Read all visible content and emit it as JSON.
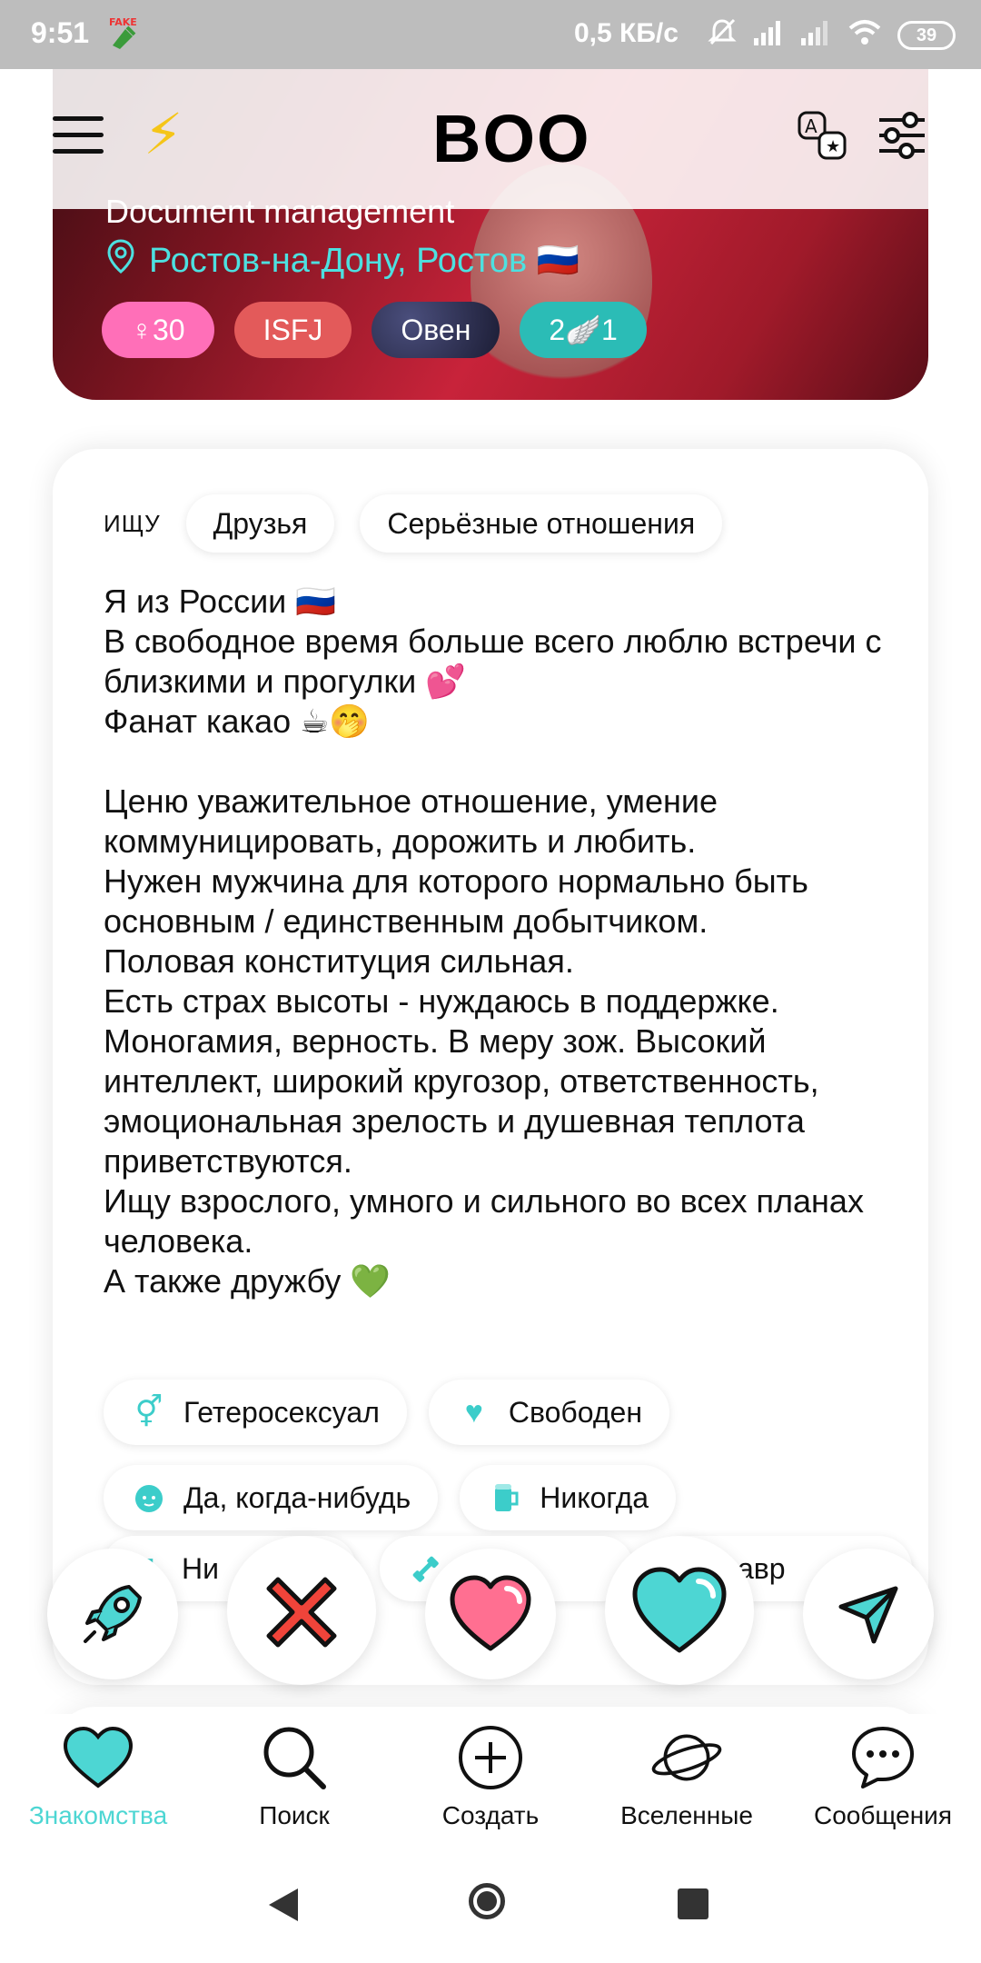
{
  "status_bar": {
    "time": "9:51",
    "fake_badge": "FAKE",
    "network_speed": "0,5 КБ/с",
    "battery": "39"
  },
  "header": {
    "logo": "BOO",
    "icons": [
      "menu-icon",
      "lightning-icon",
      "translate-icon",
      "filters-icon"
    ]
  },
  "profile": {
    "job": "Document management",
    "location": "Ростов-на-Дону, Ростов 🇷🇺",
    "chips": {
      "gender_age": "♀30",
      "mbti": "ISFJ",
      "zodiac": "Овен",
      "karma": "2🪽1"
    }
  },
  "seeking": {
    "label": "ИЩУ",
    "options": [
      "Друзья",
      "Серьёзные отношения"
    ]
  },
  "bio": "Я из России 🇷🇺\nВ свободное время больше всего люблю встречи с близкими и прогулки 💕\nФанат какао ☕🤭\n\nЦеню уважительное отношение, умение коммуницировать, дорожить и любить.\nНужен мужчина для которого нормально быть основным / единственным добытчиком.\nПоловая конституция сильная.\nЕсть страх высоты - нуждаюсь в поддержке.\nМоногамия, верность. В меру зож. Высокий интеллект, широкий кругозор, ответственность, эмоциональная зрелость и душевная теплота приветствуются.\nИщу взрослого, умного и сильного во всех планах человека.\nА также дружбу 💚",
  "tags": [
    {
      "icon": "gender-symbol-icon",
      "label": "Гетеросексуал"
    },
    {
      "icon": "heart-icon",
      "label": "Свободен"
    },
    {
      "icon": "baby-icon",
      "label": "Да, когда-нибудь"
    },
    {
      "icon": "beer-icon",
      "label": "Никогда"
    }
  ],
  "tags_partial": [
    {
      "icon": "smoking-icon",
      "label": "Ни"
    },
    {
      "icon": "dumbbell-icon",
      "label": ""
    },
    {
      "icon": "zodiac-icon",
      "label": "авр"
    }
  ],
  "actions": [
    "boost-rocket-button",
    "pass-button",
    "like-button",
    "super-like-button",
    "send-message-button"
  ],
  "bottom_nav": [
    {
      "label": "Знакомства",
      "icon": "heart-icon",
      "active": true
    },
    {
      "label": "Поиск",
      "icon": "search-icon",
      "active": false
    },
    {
      "label": "Создать",
      "icon": "plus-circle-icon",
      "active": false
    },
    {
      "label": "Вселенные",
      "icon": "planet-icon",
      "active": false
    },
    {
      "label": "Сообщения",
      "icon": "chat-icon",
      "active": false
    }
  ],
  "colors": {
    "accent": "#4dd6d3",
    "pink": "#ff6fb8",
    "red": "#e35a5a"
  }
}
